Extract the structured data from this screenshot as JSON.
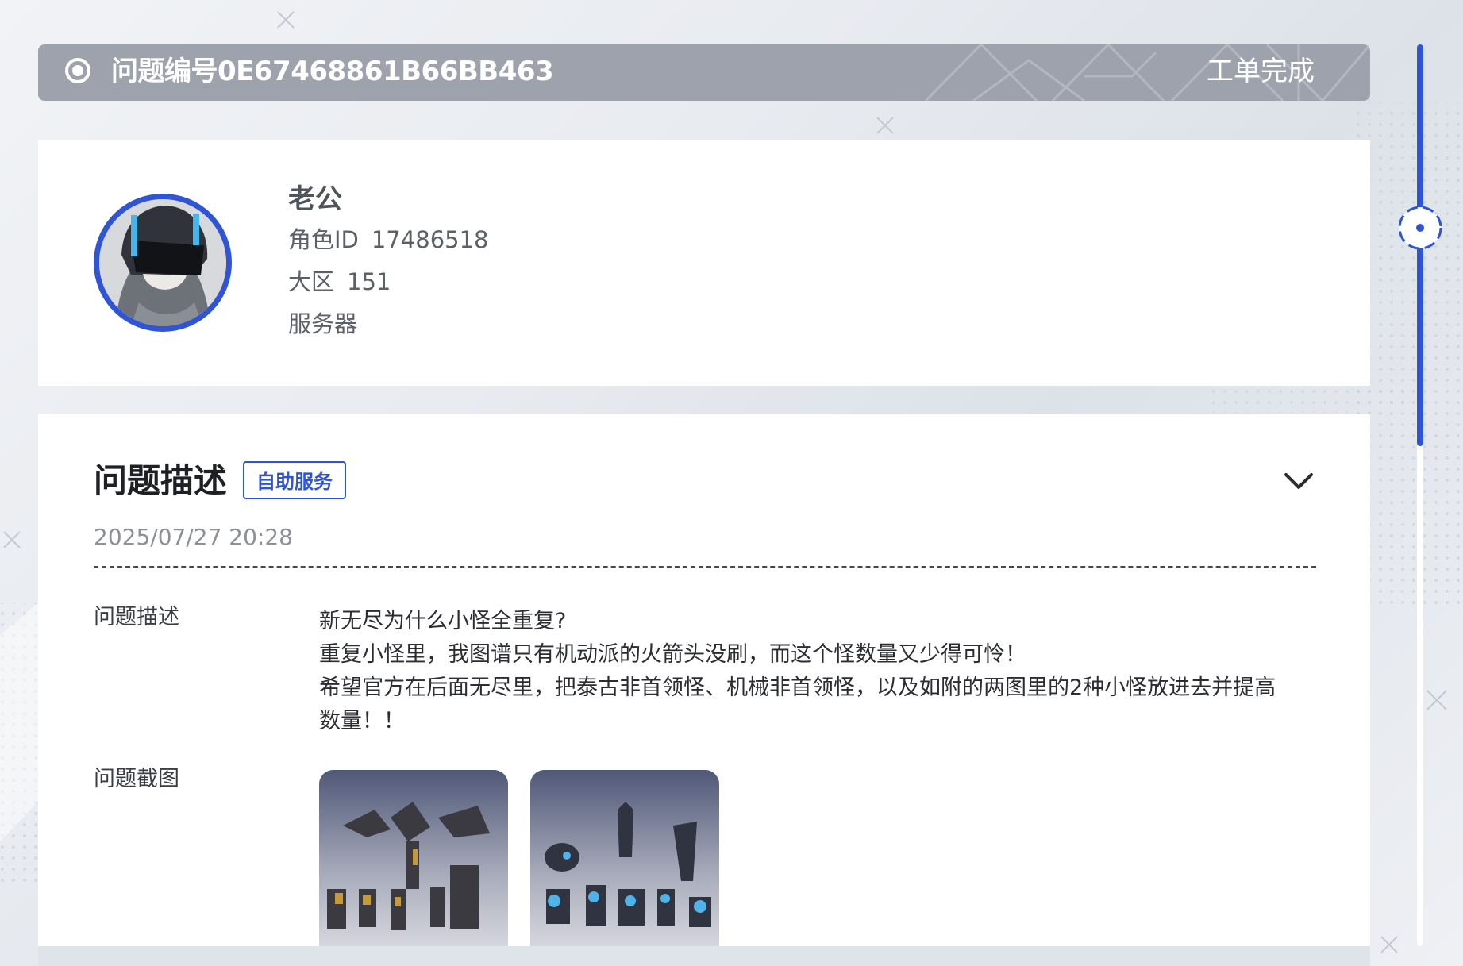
{
  "header": {
    "ticket_id": "问题编号0E67468861B66BB463",
    "status": "工单完成"
  },
  "profile": {
    "name": "老公",
    "role_id_label": "角色ID",
    "role_id_value": "17486518",
    "region_label": "大区",
    "region_value": "151",
    "server_label": "服务器"
  },
  "description": {
    "title": "问题描述",
    "badge": "自助服务",
    "date": "2025/07/27 20:28",
    "desc_label": "问题描述",
    "desc_lines": [
      "新无尽为什么小怪全重复?",
      "重复小怪里，我图谱只有机动派的火箭头没刷，而这个怪数量又少得可怜！",
      "希望官方在后面无尽里，把泰古非首领怪、机械非首领怪，以及如附的两图里的2种小怪放进去并提高",
      "数量！！"
    ],
    "screenshot_label": "问题截图"
  },
  "colors": {
    "accent": "#2f55d4",
    "header_bg": "#9ea2ac"
  },
  "icons": {
    "radio": "radio-selected-icon",
    "chevron": "chevron-down-icon",
    "scroll_knob": "scroll-handle-icon"
  }
}
